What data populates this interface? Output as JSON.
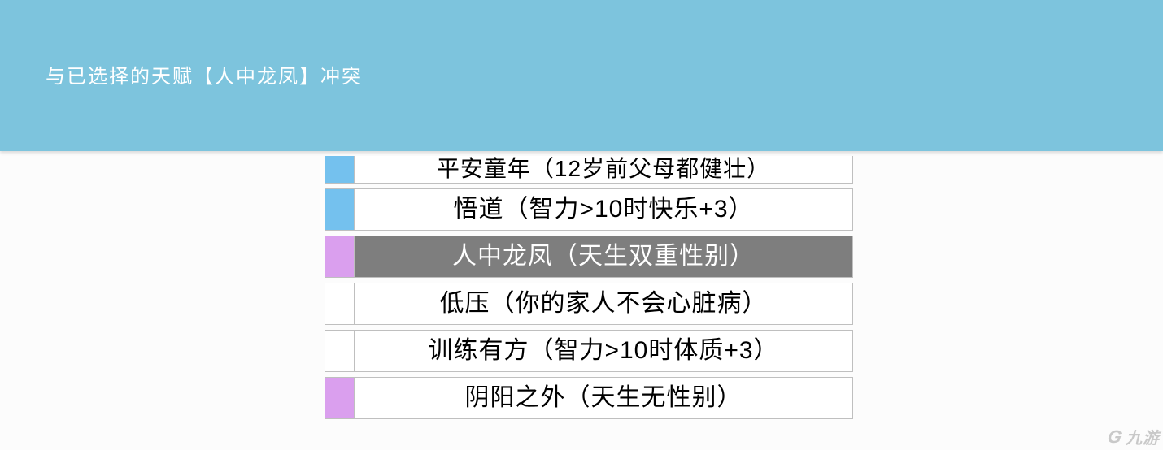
{
  "banner": {
    "message": "与已选择的天赋【人中龙凤】冲突"
  },
  "rows": [
    {
      "tag": "blue",
      "label": "平安童年（12岁前父母都健壮）",
      "selected": false,
      "cut": true
    },
    {
      "tag": "blue",
      "label": "悟道（智力>10时快乐+3）",
      "selected": false,
      "cut": false
    },
    {
      "tag": "violet",
      "label": "人中龙凤（天生双重性别）",
      "selected": true,
      "cut": false
    },
    {
      "tag": "white",
      "label": "低压（你的家人不会心脏病）",
      "selected": false,
      "cut": false
    },
    {
      "tag": "white",
      "label": "训练有方（智力>10时体质+3）",
      "selected": false,
      "cut": false
    },
    {
      "tag": "violet",
      "label": "阴阳之外（天生无性别）",
      "selected": false,
      "cut": false
    }
  ],
  "watermark": {
    "text": "九游",
    "icon": "G"
  }
}
